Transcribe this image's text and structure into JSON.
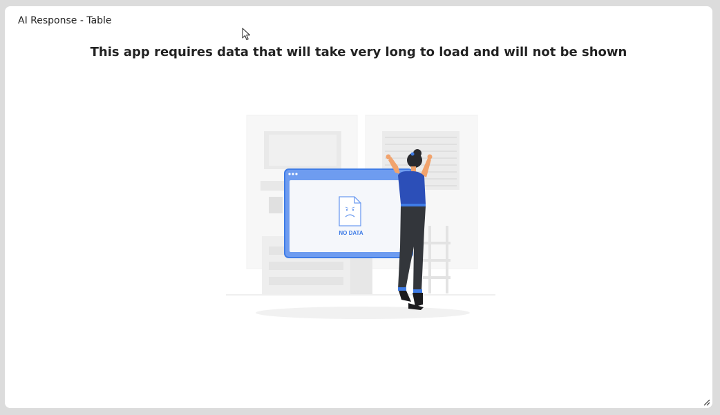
{
  "panel": {
    "title": "AI Response - Table",
    "message": "This app requires data that will take very long to load and will not be shown"
  },
  "illustration": {
    "label": "NO DATA",
    "icon": "no-data-illustration",
    "colors": {
      "accent": "#3f7ce6",
      "screen_fill": "#f5f7fb",
      "shirt": "#2c4fb8",
      "pants": "#33363b",
      "background_shapes": "#ececec"
    }
  },
  "icons": {
    "resize": "resize-handle-icon",
    "cursor": "mouse-cursor-icon"
  }
}
